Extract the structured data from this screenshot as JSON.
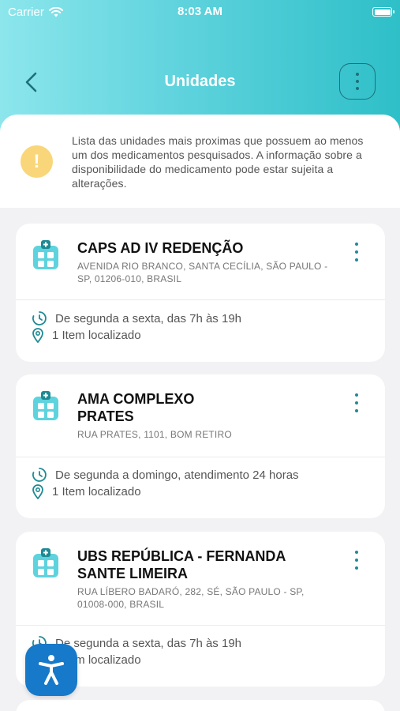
{
  "status_bar": {
    "carrier": "Carrier",
    "time": "8:03 AM"
  },
  "header": {
    "title": "Unidades"
  },
  "notice": {
    "text": "Lista das unidades mais proximas que possuem ao menos um dos medicamentos pesquisados. A informação sobre a disponibilidade do medicamento pode estar sujeita a alterações."
  },
  "units": [
    {
      "name": "CAPS AD IV REDENÇÃO",
      "address": "AVENIDA RIO BRANCO, SANTA CECÍLIA, SÃO PAULO - SP, 01206-010, BRASIL",
      "hours": "De segunda a sexta, das 7h às 19h",
      "items": "1 Item localizado"
    },
    {
      "name": "AMA COMPLEXO PRATES",
      "address": "RUA PRATES, 1101, BOM RETIRO",
      "hours": "De segunda a domingo, atendimento 24 horas",
      "items": "1 Item localizado"
    },
    {
      "name": "UBS REPÚBLICA - FERNANDA SANTE LIMEIRA",
      "address": "RUA LÍBERO BADARÓ, 282, SÉ, SÃO PAULO - SP, 01008-000, BRASIL",
      "hours": "De segunda a sexta, das 7h às 19h",
      "items": "1 Item localizado"
    }
  ],
  "colors": {
    "accent": "#2ebfc8",
    "icon_teal": "#1f8a94",
    "warning": "#fad67a",
    "fab": "#1779c9"
  },
  "icons": {
    "back": "chevron-left-icon",
    "menu": "more-vertical-icon",
    "warning": "exclamation-icon",
    "unit": "health-unit-icon",
    "clock": "clock-icon",
    "location": "map-pin-icon",
    "accessibility": "accessibility-icon"
  }
}
